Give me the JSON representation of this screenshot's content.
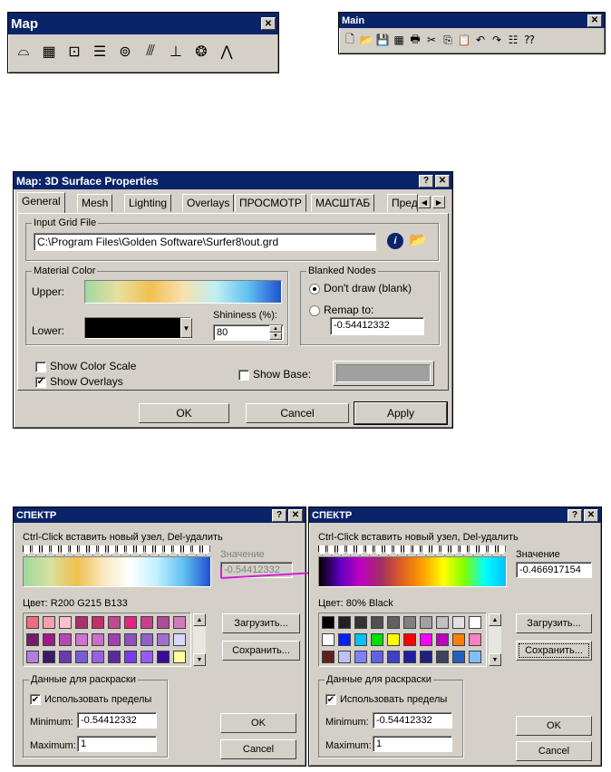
{
  "map_toolbar": {
    "title": "Map",
    "icons": [
      "map-outline-icon",
      "grid-icon",
      "points-icon",
      "list-icon",
      "camera-icon",
      "lines-icon",
      "axes-icon",
      "globe-icon",
      "triangle-icon"
    ],
    "glyphs": [
      "⌓",
      "▦",
      "⊡",
      "☰",
      "⊚",
      "⫻",
      "⊥",
      "❂",
      "⋀"
    ]
  },
  "main_toolbar": {
    "title": "Main",
    "glyphs": [
      "🗋",
      "📂",
      "💾",
      "▦",
      "🖶",
      "✂",
      "⎘",
      "📋",
      "↶",
      "↷",
      "☷",
      "⁇"
    ]
  },
  "props": {
    "title": "Map: 3D Surface Properties",
    "tabs": [
      "General",
      "Mesh",
      "Lighting",
      "Overlays",
      "ПРОСМОТР",
      "МАСШТАБ",
      "Пред"
    ],
    "input_group": "Input Grid File",
    "grid_path": "C:\\Program Files\\Golden Software\\Surfer8\\out.grd",
    "material_group": "Material Color",
    "upper_label": "Upper:",
    "lower_label": "Lower:",
    "shininess_label": "Shininess (%):",
    "shininess_value": "80",
    "blanked_group": "Blanked Nodes",
    "radio_dont_draw": "Don't draw (blank)",
    "radio_remap": "Remap to:",
    "remap_value": "-0.54412332",
    "show_color_scale": "Show Color Scale",
    "show_overlays": "Show Overlays",
    "show_base": "Show Base:",
    "ok": "OK",
    "cancel": "Cancel",
    "apply": "Apply"
  },
  "spectrum_left": {
    "title": "СПЕКТР",
    "hint": "Ctrl-Click вставить новый узел, Del-удалить",
    "value_label": "Значение",
    "value": "-0.54412332",
    "color_text": "Цвет:  R200 G215 B133",
    "load": "Загрузить...",
    "save": "Сохранить...",
    "data_group": "Данные для раскраски",
    "use_limits": "Использовать пределы",
    "minimum_label": "Minimum:",
    "minimum": "-0.54412332",
    "maximum_label": "Maximum:",
    "maximum": "1",
    "ok": "OK",
    "cancel": "Cancel",
    "swatches": [
      "#f06a80",
      "#f5a0b0",
      "#f8c0d0",
      "#a8306a",
      "#c0306a",
      "#c04a90",
      "#e8208a",
      "#c8408a",
      "#b04a9a",
      "#d07ac0",
      "#7a1a6a",
      "#a01a8a",
      "#b04ab0",
      "#d070d0",
      "#c870c8",
      "#a040b0",
      "#9050c0",
      "#9060c8",
      "#a070d0",
      "#d8d8ff",
      "#b080e0",
      "#3a1a6a",
      "#6a3ab0",
      "#7a5ad0",
      "#9a60e0",
      "#5a2aa0",
      "#7a3af0",
      "#9a5af8",
      "#3a0a9a",
      "#ffffa0"
    ]
  },
  "spectrum_right": {
    "title": "СПЕКТР",
    "hint": "Ctrl-Click вставить новый узел, Del-удалить",
    "value_label": "Значение",
    "value": "-0.466917154",
    "color_text": "Цвет:  80% Black",
    "load": "Загрузить...",
    "save": "Сохранить...",
    "data_group": "Данные для раскраски",
    "use_limits": "Использовать пределы",
    "minimum_label": "Minimum:",
    "minimum": "-0.54412332",
    "maximum_label": "Maximum:",
    "maximum": "1",
    "ok": "OK",
    "cancel": "Cancel",
    "swatches": [
      "#000000",
      "#202020",
      "#333333",
      "#505050",
      "#606060",
      "#808080",
      "#a0a0a0",
      "#c0c0c0",
      "#e0e0e0",
      "#ffffff",
      "#ffffff",
      "#0020ff",
      "#00c0ff",
      "#00e000",
      "#ffff00",
      "#ff0000",
      "#ff00ff",
      "#c000c0",
      "#ff8000",
      "#ff80c0",
      "#602020",
      "#c0c0ff",
      "#8080ff",
      "#6060e0",
      "#4040c0",
      "#2020a0",
      "#202080",
      "#404060",
      "#2060c0",
      "#80c0ff"
    ]
  }
}
